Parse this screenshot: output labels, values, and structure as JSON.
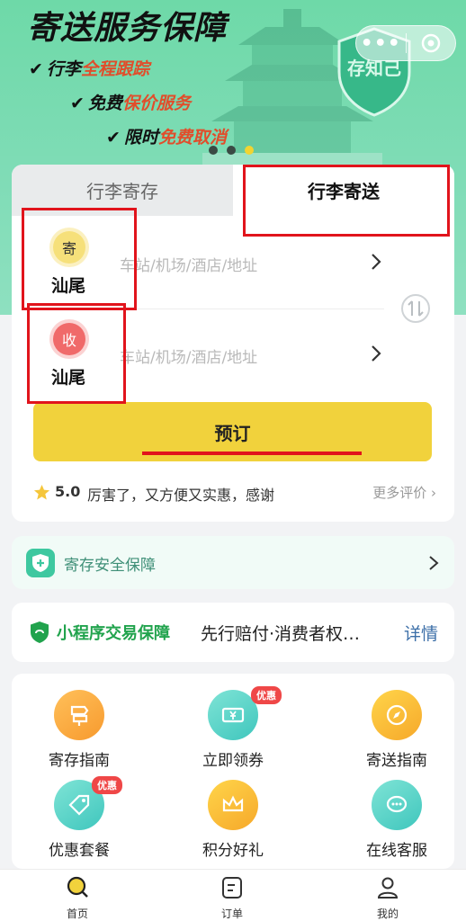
{
  "banner": {
    "title": "寄送服务保障",
    "features": [
      {
        "check": "✔",
        "plain": "行李",
        "highlight": "全程跟踪"
      },
      {
        "check": "✔",
        "plain": "免费",
        "highlight": "保价服务"
      },
      {
        "check": "✔",
        "plain": "限时",
        "highlight": "免费取消"
      }
    ],
    "shield_text": "存知己",
    "carousel": {
      "count": 3,
      "active_index": 2
    },
    "capsule": {
      "more": "•••"
    }
  },
  "booking": {
    "tabs": [
      {
        "label": "行李寄存",
        "active": false
      },
      {
        "label": "行李寄送",
        "active": true
      }
    ],
    "sender": {
      "badge": "寄",
      "city": "汕尾",
      "placeholder": "车站/机场/酒店/地址"
    },
    "receiver": {
      "badge": "收",
      "city": "汕尾",
      "placeholder": "车站/机场/酒店/地址"
    },
    "book_label": "预订",
    "review": {
      "score": "5.0",
      "text": "厉害了，又方便又实惠，感谢",
      "more": "更多评价"
    }
  },
  "safety": {
    "label": "寄存安全保障"
  },
  "guarantee": {
    "label": "小程序交易保障",
    "desc": "先行赔付·消费者权…",
    "detail": "详情"
  },
  "grid": {
    "items": [
      {
        "label": "寄存指南",
        "icon": "sign-icon"
      },
      {
        "label": "立即领券",
        "icon": "coupon-icon",
        "tag": "优惠"
      },
      {
        "label": "寄送指南",
        "icon": "compass-icon"
      },
      {
        "label": "优惠套餐",
        "icon": "tag-icon",
        "tag": "优惠"
      },
      {
        "label": "积分好礼",
        "icon": "crown-icon"
      },
      {
        "label": "在线客服",
        "icon": "chat-icon"
      }
    ]
  },
  "nav": {
    "items": [
      {
        "label": "首页",
        "icon": "search-icon",
        "active": true
      },
      {
        "label": "订单",
        "icon": "order-icon"
      },
      {
        "label": "我的",
        "icon": "user-icon"
      }
    ]
  },
  "colors": {
    "accent": "#f1d23c",
    "brand_green": "#6ed9a8",
    "annotation_red": "#e1141c"
  }
}
